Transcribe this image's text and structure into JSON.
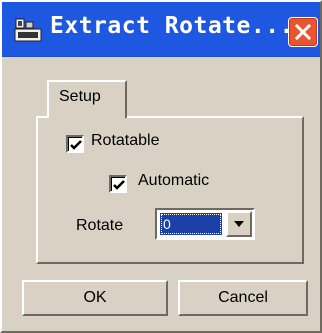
{
  "window": {
    "title": "Extract Rotate...",
    "icon": "app-icon",
    "close_icon": "close-icon",
    "accent_color": "#1f58e0",
    "close_color": "#e8552e"
  },
  "tabs": [
    {
      "label": "Setup"
    }
  ],
  "setup": {
    "rotatable": {
      "label": "Rotatable",
      "checked": true
    },
    "automatic": {
      "label": "Automatic",
      "checked": true
    },
    "rotate": {
      "label": "Rotate",
      "selected_value": "0",
      "arrow_icon": "chevron-down-icon"
    }
  },
  "buttons": {
    "ok_label": "OK",
    "cancel_label": "Cancel"
  }
}
